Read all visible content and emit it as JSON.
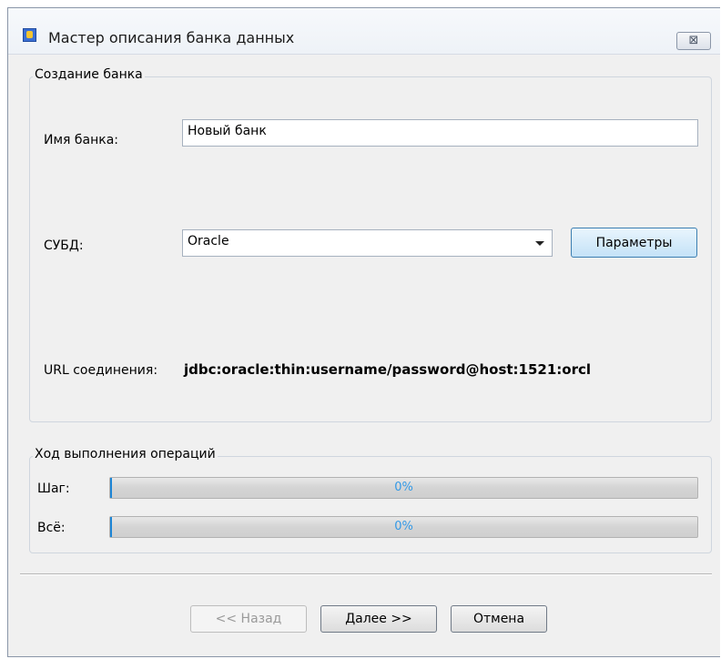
{
  "window": {
    "title": "Мастер описания банка данных",
    "close_glyph": "⊠"
  },
  "create_group": {
    "legend": "Создание банка",
    "bank_name_label": "Имя банка:",
    "bank_name_value": "Новый банк",
    "dbms_label": "СУБД:",
    "dbms_value": "Oracle",
    "params_button": "Параметры",
    "url_label": "URL соединения:",
    "url_value": "jdbc:oracle:thin:username/password@host:1521:orcl"
  },
  "progress_group": {
    "legend": "Ход выполнения операций",
    "step_label": "Шаг:",
    "step_text": "0%",
    "step_fraction": 0.0,
    "all_label": "Всё:",
    "all_text": "0%",
    "all_fraction": 0.0
  },
  "footer": {
    "back_button": "<< Назад",
    "next_button": "Далее >>",
    "cancel_button": "Отмена"
  },
  "colors": {
    "progress_accent": "#1e86d6",
    "params_button_tint": "#c4e2f7"
  }
}
